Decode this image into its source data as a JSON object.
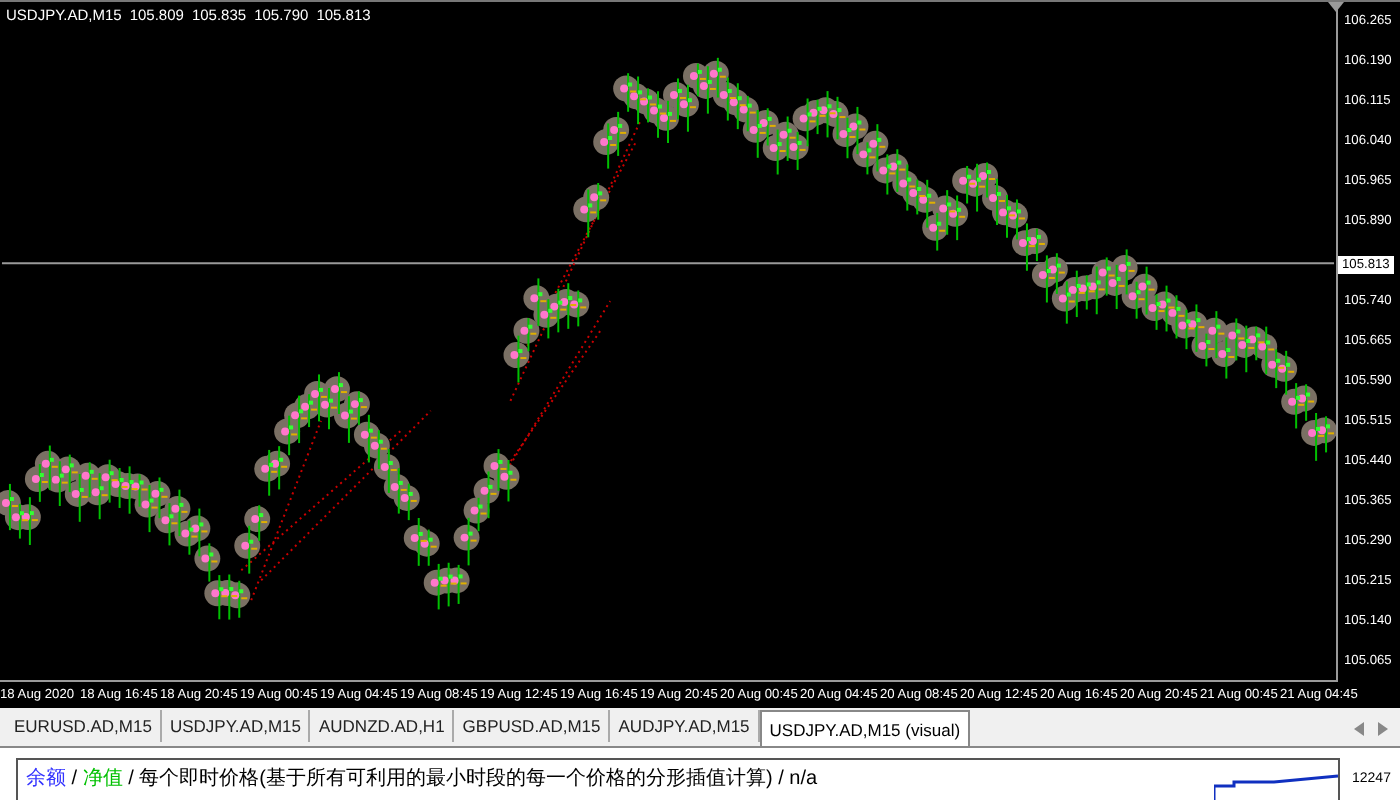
{
  "chart": {
    "symbol": "USDJPY.AD,M15",
    "ohlc": [
      "105.809",
      "105.835",
      "105.790",
      "105.813"
    ],
    "current_price": "105.813",
    "price_axis": [
      "106.265",
      "106.190",
      "106.115",
      "106.040",
      "105.965",
      "105.890",
      "105.740",
      "105.665",
      "105.590",
      "105.515",
      "105.440",
      "105.365",
      "105.290",
      "105.215",
      "105.140",
      "105.065"
    ],
    "time_axis": [
      "18 Aug 2020",
      "18 Aug 16:45",
      "18 Aug 20:45",
      "19 Aug 00:45",
      "19 Aug 04:45",
      "19 Aug 08:45",
      "19 Aug 12:45",
      "19 Aug 16:45",
      "19 Aug 20:45",
      "20 Aug 00:45",
      "20 Aug 04:45",
      "20 Aug 08:45",
      "20 Aug 12:45",
      "20 Aug 16:45",
      "20 Aug 20:45",
      "21 Aug 00:45",
      "21 Aug 04:45"
    ]
  },
  "tabs": [
    {
      "label": "EURUSD.AD,M15",
      "selected": false
    },
    {
      "label": "USDJPY.AD,M15",
      "selected": false
    },
    {
      "label": "AUDNZD.AD,H1",
      "selected": false
    },
    {
      "label": "GBPUSD.AD,M15",
      "selected": false
    },
    {
      "label": "AUDJPY.AD,M15",
      "selected": false
    },
    {
      "label": "USDJPY.AD,M15 (visual)",
      "selected": true
    }
  ],
  "report_graph": {
    "legend": [
      {
        "text": "余额",
        "color": "#3333ff"
      },
      {
        "text": " / ",
        "color": "#000000"
      },
      {
        "text": "净值",
        "color": "#00c000"
      },
      {
        "text": " / 每个即时价格(基于所有可利用的最小时段的每一个价格的分形插值计算) / n/a",
        "color": "#000000"
      }
    ],
    "axis_value": "12247"
  }
}
